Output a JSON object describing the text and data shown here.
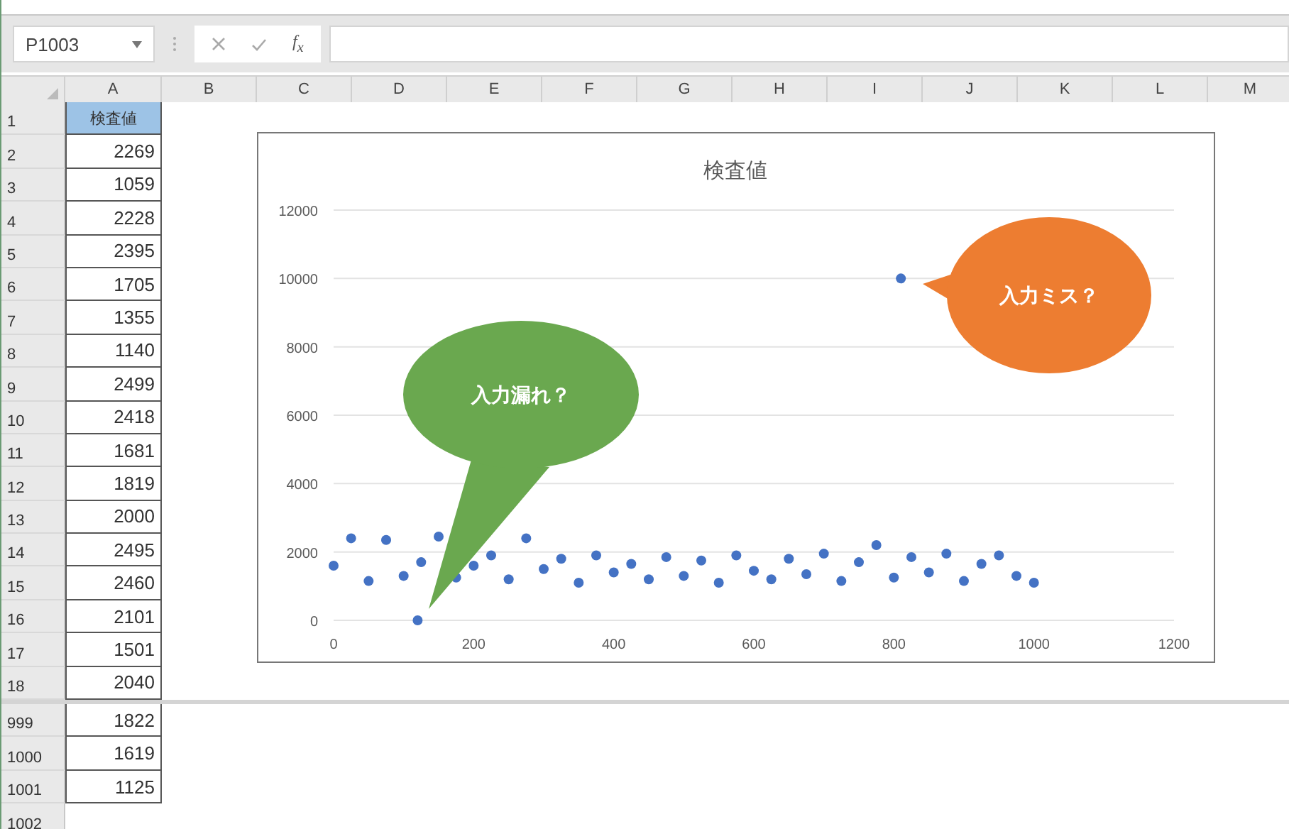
{
  "name_box": "P1003",
  "formula_bar": {
    "function_label": "f$_{x}$"
  },
  "columns": [
    "A",
    "B",
    "C",
    "D",
    "E",
    "F",
    "G",
    "H",
    "I",
    "J",
    "K",
    "L",
    "M"
  ],
  "row_groups": [
    [
      {
        "row": "1",
        "value": "検査値",
        "kind": "header"
      },
      {
        "row": "2",
        "value": "2269",
        "kind": "value"
      },
      {
        "row": "3",
        "value": "1059",
        "kind": "value"
      },
      {
        "row": "4",
        "value": "2228",
        "kind": "value"
      },
      {
        "row": "5",
        "value": "2395",
        "kind": "value"
      },
      {
        "row": "6",
        "value": "1705",
        "kind": "value"
      },
      {
        "row": "7",
        "value": "1355",
        "kind": "value"
      },
      {
        "row": "8",
        "value": "1140",
        "kind": "value"
      },
      {
        "row": "9",
        "value": "2499",
        "kind": "value"
      },
      {
        "row": "10",
        "value": "2418",
        "kind": "value"
      },
      {
        "row": "11",
        "value": "1681",
        "kind": "value"
      },
      {
        "row": "12",
        "value": "1819",
        "kind": "value"
      },
      {
        "row": "13",
        "value": "2000",
        "kind": "value"
      },
      {
        "row": "14",
        "value": "2495",
        "kind": "value"
      },
      {
        "row": "15",
        "value": "2460",
        "kind": "value"
      },
      {
        "row": "16",
        "value": "2101",
        "kind": "value"
      },
      {
        "row": "17",
        "value": "1501",
        "kind": "value"
      },
      {
        "row": "18",
        "value": "2040",
        "kind": "value"
      }
    ],
    [
      {
        "row": "999",
        "value": "1822",
        "kind": "value"
      },
      {
        "row": "1000",
        "value": "1619",
        "kind": "value"
      },
      {
        "row": "1001",
        "value": "1125",
        "kind": "value"
      },
      {
        "row": "1002",
        "kind": "empty"
      }
    ]
  ],
  "chart": {
    "chart_data": {
      "type": "scatter",
      "title": "検査値",
      "xlim": [
        0,
        1200
      ],
      "ylim": [
        0,
        12000
      ],
      "xticks": [
        0,
        200,
        400,
        600,
        800,
        1000,
        1200
      ],
      "yticks": [
        0,
        2000,
        4000,
        6000,
        8000,
        10000,
        12000
      ],
      "grid": true,
      "x": [
        0,
        25,
        50,
        75,
        100,
        120,
        125,
        150,
        175,
        200,
        225,
        250,
        275,
        300,
        325,
        350,
        375,
        400,
        425,
        450,
        475,
        500,
        525,
        550,
        575,
        600,
        625,
        650,
        675,
        700,
        725,
        750,
        775,
        800,
        810,
        825,
        850,
        875,
        900,
        925,
        950,
        975,
        1000
      ],
      "series": [
        {
          "color": "#4472c4",
          "values": [
            1600,
            2400,
            1150,
            2350,
            1300,
            0,
            1700,
            2450,
            1250,
            1600,
            1900,
            1200,
            2400,
            1500,
            1800,
            1100,
            1900,
            1400,
            1650,
            1200,
            1850,
            1300,
            1750,
            1100,
            1900,
            1450,
            1200,
            1800,
            1350,
            1950,
            1150,
            1700,
            2200,
            1250,
            10000,
            1850,
            1400,
            1950,
            1150,
            1650,
            1900,
            1300,
            1100
          ]
        }
      ]
    },
    "callouts": [
      {
        "text": "入力漏れ？",
        "color": "#6aa84f"
      },
      {
        "text": "入力ミス？",
        "color": "#ed7d31"
      }
    ]
  }
}
